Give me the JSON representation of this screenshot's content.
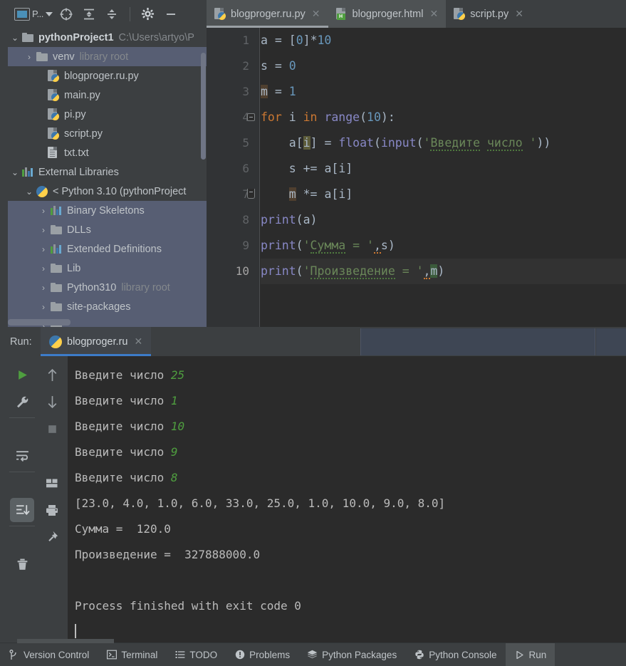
{
  "toolbar": {
    "project_widget_label": "P...",
    "icons": [
      {
        "name": "project-widget-icon",
        "glyph": ""
      },
      {
        "name": "target-icon",
        "glyph": "⊕"
      },
      {
        "name": "expand-all-icon",
        "glyph": "⤓"
      },
      {
        "name": "collapse-all-icon",
        "glyph": "⤒"
      },
      {
        "name": "settings-gear-icon",
        "glyph": "⚙"
      },
      {
        "name": "minimize-icon",
        "glyph": "—"
      }
    ]
  },
  "tabs": [
    {
      "label": "blogproger.ru.py",
      "icon": "python-file-icon",
      "active": true,
      "close": "✕"
    },
    {
      "label": "blogproger.html",
      "icon": "html-file-icon",
      "active": false,
      "close": "✕"
    },
    {
      "label": "script.py",
      "icon": "python-file-icon",
      "active": false,
      "close": "✕"
    }
  ],
  "sidebar": {
    "items": [
      {
        "label": "pythonProject1",
        "suffix": "C:\\Users\\artyo\\P",
        "icon": "folder-icon",
        "arrow": "⌄",
        "indent": 0,
        "bold": true,
        "selected": false
      },
      {
        "label": "venv",
        "suffix": "library root",
        "icon": "folder-icon",
        "arrow": "›",
        "indent": 1,
        "bold": false,
        "selected": true
      },
      {
        "label": "blogproger.ru.py",
        "suffix": "",
        "icon": "python-file-icon",
        "arrow": "",
        "indent": 2,
        "bold": false,
        "selected": false
      },
      {
        "label": "main.py",
        "suffix": "",
        "icon": "python-file-icon",
        "arrow": "",
        "indent": 2,
        "bold": false,
        "selected": false
      },
      {
        "label": "pi.py",
        "suffix": "",
        "icon": "python-file-icon",
        "arrow": "",
        "indent": 2,
        "bold": false,
        "selected": false
      },
      {
        "label": "script.py",
        "suffix": "",
        "icon": "python-file-icon",
        "arrow": "",
        "indent": 2,
        "bold": false,
        "selected": false
      },
      {
        "label": "txt.txt",
        "suffix": "",
        "icon": "text-file-icon",
        "arrow": "",
        "indent": 2,
        "bold": false,
        "selected": false
      },
      {
        "label": "External Libraries",
        "suffix": "",
        "icon": "library-bars-icon",
        "arrow": "⌄",
        "indent": 0,
        "bold": false,
        "selected": false
      },
      {
        "label": "< Python 3.10 (pythonProject",
        "suffix": "",
        "icon": "python-interpreter-icon",
        "arrow": "⌄",
        "indent": 1,
        "bold": false,
        "selected": false
      },
      {
        "label": "Binary Skeletons",
        "suffix": "",
        "icon": "library-bars-icon",
        "arrow": "›",
        "indent": 2,
        "bold": false,
        "selected": true
      },
      {
        "label": "DLLs",
        "suffix": "",
        "icon": "folder-icon",
        "arrow": "›",
        "indent": 2,
        "bold": false,
        "selected": true
      },
      {
        "label": "Extended Definitions",
        "suffix": "",
        "icon": "library-bars-icon",
        "arrow": "›",
        "indent": 2,
        "bold": false,
        "selected": true
      },
      {
        "label": "Lib",
        "suffix": "",
        "icon": "folder-icon",
        "arrow": "›",
        "indent": 2,
        "bold": false,
        "selected": true
      },
      {
        "label": "Python310",
        "suffix": "library root",
        "icon": "folder-icon",
        "arrow": "›",
        "indent": 2,
        "bold": false,
        "selected": true
      },
      {
        "label": "site-packages",
        "suffix": "",
        "icon": "folder-icon",
        "arrow": "›",
        "indent": 2,
        "bold": false,
        "selected": true
      }
    ]
  },
  "editor": {
    "line_numbers": [
      "1",
      "2",
      "3",
      "4",
      "5",
      "6",
      "7",
      "8",
      "9",
      "10"
    ],
    "current_line": 10,
    "code_lines": [
      "a = [0]*10",
      "s = 0",
      "m = 1",
      "for i in range(10):",
      "    a[i] = float(input('Введите число '))",
      "    s += a[i]",
      "    m *= a[i]",
      "print(a)",
      "print('Сумма = ',s)",
      "print('Произведение = ',m)"
    ]
  },
  "run": {
    "label": "Run:",
    "tab_label": "blogproger.ru",
    "tab_close": "✕",
    "toolbar_icons": [
      {
        "name": "rerun-play-icon",
        "glyph": "▶"
      },
      {
        "name": "scroll-up-icon",
        "glyph": "↑"
      },
      {
        "name": "run-settings-wrench-icon",
        "glyph": "🔧"
      },
      {
        "name": "scroll-down-icon",
        "glyph": "↓"
      },
      {
        "name": "stop-icon",
        "glyph": "■"
      },
      {
        "name": "soft-wrap-icon",
        "glyph": "⏎"
      },
      {
        "name": "layout-icon",
        "glyph": "▤"
      },
      {
        "name": "scroll-to-end-icon",
        "glyph": "⇟"
      },
      {
        "name": "print-icon",
        "glyph": "🖨"
      },
      {
        "name": "pin-tab-icon",
        "glyph": "📌"
      },
      {
        "name": "clear-all-trash-icon",
        "glyph": "🗑"
      }
    ],
    "console": [
      {
        "prompt": "Введите число ",
        "input": "25"
      },
      {
        "prompt": "Введите число ",
        "input": "1"
      },
      {
        "prompt": "Введите число ",
        "input": "10"
      },
      {
        "prompt": "Введите число ",
        "input": "9"
      },
      {
        "prompt": "Введите число ",
        "input": "8"
      },
      {
        "prompt": "[23.0, 4.0, 1.0, 6.0, 33.0, 25.0, 1.0, 10.0, 9.0, 8.0]",
        "input": ""
      },
      {
        "prompt": "Сумма =  120.0",
        "input": ""
      },
      {
        "prompt": "Произведение =  327888000.0",
        "input": ""
      },
      {
        "prompt": "",
        "input": ""
      },
      {
        "prompt": "Process finished with exit code 0",
        "input": ""
      }
    ]
  },
  "statusbar": {
    "items": [
      {
        "label": "Version Control",
        "icon": "branch-icon",
        "glyph": "⑂",
        "active": false
      },
      {
        "label": "Terminal",
        "icon": "terminal-icon",
        "glyph": "▣",
        "active": false
      },
      {
        "label": "TODO",
        "icon": "todo-list-icon",
        "glyph": "☰",
        "active": false
      },
      {
        "label": "Problems",
        "icon": "problems-warning-icon",
        "glyph": "❶",
        "active": false
      },
      {
        "label": "Python Packages",
        "icon": "packages-stack-icon",
        "glyph": "❖",
        "active": false
      },
      {
        "label": "Python Console",
        "icon": "python-console-icon",
        "glyph": "🐍",
        "active": false
      },
      {
        "label": "Run",
        "icon": "run-play-icon",
        "glyph": "▶",
        "active": true
      }
    ]
  },
  "colors": {
    "accent_blue": "#3d7cc9",
    "selection": "#575e73",
    "editor_bg": "#2b2b2b",
    "chrome_bg": "#3c3f41",
    "keyword": "#cc7832",
    "string": "#6a8759",
    "number": "#6897bb",
    "function": "#8888c6",
    "console_input": "#4f9e3f"
  }
}
